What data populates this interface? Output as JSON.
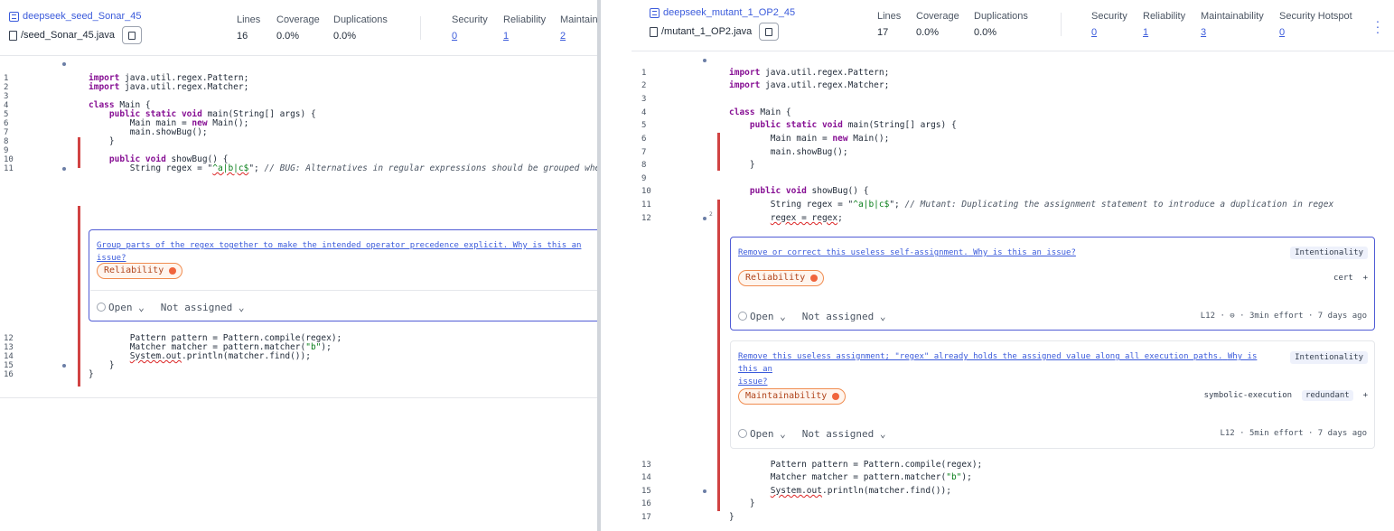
{
  "left": {
    "project_name": "deepseek_seed_Sonar_45",
    "file_name": "/seed_Sonar_45.java",
    "metrics": {
      "lines_label": "Lines",
      "lines_value": "16",
      "coverage_label": "Coverage",
      "coverage_value": "0.0%",
      "dup_label": "Duplications",
      "dup_value": "0.0%",
      "security_label": "Security",
      "security_value": "0",
      "reliability_label": "Reliability",
      "reliability_value": "1",
      "maint_label": "Maintain",
      "maint_value": "2"
    },
    "lines": {
      "l1": {
        "n": "1",
        "a": "import",
        "b": " java.util.regex.Pattern;"
      },
      "l2": {
        "n": "2",
        "a": "import",
        "b": " java.util.regex.Matcher;"
      },
      "l3": {
        "n": "3"
      },
      "l4": {
        "n": "4",
        "a": "class",
        "b": " Main {"
      },
      "l5": {
        "n": "5",
        "a": "    public static void",
        "b": " main(String[] args) {"
      },
      "l6": {
        "n": "6",
        "a": "        Main main = ",
        "b": "new",
        "c": " Main();"
      },
      "l7": {
        "n": "7",
        "a": "        main.showBug();"
      },
      "l8": {
        "n": "8",
        "a": "    }"
      },
      "l9": {
        "n": "9"
      },
      "l10": {
        "n": "10",
        "a": "    public void",
        "b": " showBug() {"
      },
      "l11": {
        "n": "11",
        "a": "        String regex = \"",
        "b": "^a|b|c$",
        "c": "\";",
        "d": " // BUG: Alternatives in regular expressions should be grouped when used with"
      },
      "l12": {
        "n": "12",
        "a": "        Pattern pattern = Pattern.compile(regex);"
      },
      "l13": {
        "n": "13",
        "a": "        Matcher matcher = pattern.matcher(",
        "b": "\"b\"",
        "c": ");"
      },
      "l14": {
        "n": "14",
        "a": "        ",
        "b": "System.out",
        "c": ".println(matcher.find());"
      },
      "l15": {
        "n": "15",
        "a": "    }"
      },
      "l16": {
        "n": "16",
        "a": "}"
      }
    },
    "issue": {
      "message": "Group parts of the regex together to make the intended operator precedence explicit.",
      "why": "Why is this an issue?",
      "quality": "Reliability",
      "status": "Open",
      "assignee": "Not assigned"
    }
  },
  "right": {
    "project_name": "deepseek_mutant_1_OP2_45",
    "file_name": "/mutant_1_OP2.java",
    "metrics": {
      "lines_label": "Lines",
      "lines_value": "17",
      "coverage_label": "Coverage",
      "coverage_value": "0.0%",
      "dup_label": "Duplications",
      "dup_value": "0.0%",
      "security_label": "Security",
      "security_value": "0",
      "reliability_label": "Reliability",
      "reliability_value": "1",
      "maint_label": "Maintainability",
      "maint_value": "3",
      "hotspot_label": "Security Hotspot",
      "hotspot_value": "0"
    },
    "lines": {
      "l1": {
        "n": "1",
        "a": "import",
        "b": " java.util.regex.Pattern;"
      },
      "l2": {
        "n": "2",
        "a": "import",
        "b": " java.util.regex.Matcher;"
      },
      "l3": {
        "n": "3"
      },
      "l4": {
        "n": "4",
        "a": "class",
        "b": " Main {"
      },
      "l5": {
        "n": "5",
        "a": "    public static void",
        "b": " main(String[] args) {"
      },
      "l6": {
        "n": "6",
        "a": "        Main main = ",
        "b": "new",
        "c": " Main();"
      },
      "l7": {
        "n": "7",
        "a": "        main.showBug();"
      },
      "l8": {
        "n": "8",
        "a": "    }"
      },
      "l9": {
        "n": "9"
      },
      "l10": {
        "n": "10",
        "a": "    public void",
        "b": " showBug() {"
      },
      "l11": {
        "n": "11",
        "a": "        String regex = \"",
        "b": "^a|b|c$",
        "c": "\";",
        "d": " // Mutant: Duplicating the assignment statement to introduce a duplication in regex"
      },
      "l12": {
        "n": "12",
        "a": "        ",
        "b": "regex = regex",
        "c": ";"
      },
      "l13": {
        "n": "13",
        "a": "        Pattern pattern = Pattern.compile(regex);"
      },
      "l14": {
        "n": "14",
        "a": "        Matcher matcher = pattern.matcher(",
        "b": "\"b\"",
        "c": ");"
      },
      "l15": {
        "n": "15",
        "a": "        ",
        "b": "System.out",
        "c": ".println(matcher.find());"
      },
      "l16": {
        "n": "16",
        "a": "    }"
      },
      "l17": {
        "n": "17",
        "a": "}"
      }
    },
    "issue1": {
      "message": "Remove or correct this useless self-assignment.",
      "why": "Why is this an issue?",
      "attribute": "Intentionality",
      "quality": "Reliability",
      "tags": "cert",
      "plus": "+",
      "status": "Open",
      "assignee": "Not assigned",
      "meta": "L12 · ⊖ · 3min effort · 7 days ago"
    },
    "issue2": {
      "message_a": "Remove this useless assignment; \"regex\" already holds the assigned value along all execution paths.",
      "message_b": "Why is this an",
      "message_c": "issue?",
      "attribute": "Intentionality",
      "quality": "Maintainability",
      "tag1": "symbolic-execution",
      "tag2": "redundant",
      "plus": "+",
      "status": "Open",
      "assignee": "Not assigned",
      "meta": "L12 · 5min effort · 7 days ago"
    },
    "dot_badge": "2"
  }
}
